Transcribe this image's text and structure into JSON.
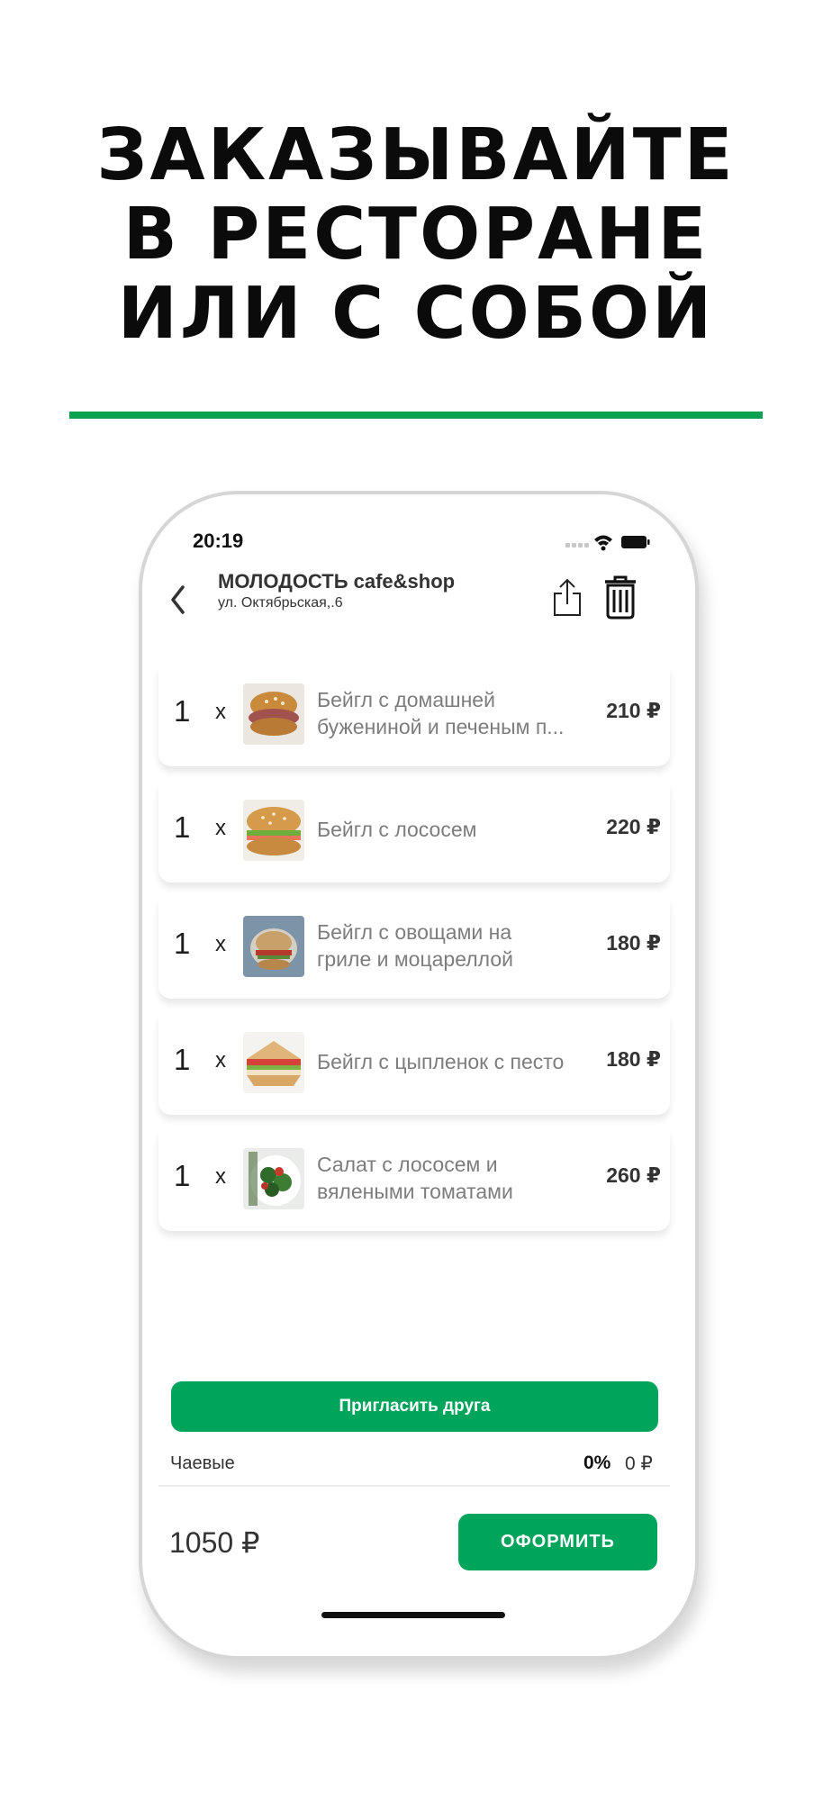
{
  "headline": {
    "line1": "ЗАКАЗЫВАЙТЕ",
    "line2": "В РЕСТОРАНЕ",
    "line3": "ИЛИ С СОБОЙ"
  },
  "status_bar": {
    "time": "20:19",
    "icons": [
      "signal-icon",
      "wifi-icon",
      "battery-icon"
    ]
  },
  "header": {
    "shop_name": "МОЛОДОСТЬ cafe&shop",
    "address": "ул. Октябрьская,.6",
    "icons": [
      "back-chevron-icon",
      "share-icon",
      "trash-icon"
    ]
  },
  "cart": {
    "items": [
      {
        "qty": "1",
        "times": "х",
        "name_line1": "Бейгл с домашней",
        "name_line2": "бужениной и печеным п...",
        "price": "210 ₽",
        "image": "bagel-pork-icon"
      },
      {
        "qty": "1",
        "times": "х",
        "name_line1": "Бейгл с лососем",
        "name_line2": "",
        "price": "220 ₽",
        "image": "bagel-salmon-icon"
      },
      {
        "qty": "1",
        "times": "х",
        "name_line1": "Бейгл с овощами на",
        "name_line2": "гриле и моцареллой",
        "price": "180 ₽",
        "image": "bagel-vegetables-icon"
      },
      {
        "qty": "1",
        "times": "х",
        "name_line1": "Бейгл с цыпленок с песто",
        "name_line2": "",
        "price": "180 ₽",
        "image": "bagel-chicken-icon"
      },
      {
        "qty": "1",
        "times": "х",
        "name_line1": "Салат с лососем и",
        "name_line2": "вялеными томатами",
        "price": "260 ₽",
        "image": "salad-salmon-icon"
      }
    ]
  },
  "invite_button": {
    "label": "Пригласить друга"
  },
  "tips": {
    "label": "Чаевые",
    "percent": "0%",
    "amount": "0 ₽"
  },
  "footer": {
    "total": "1050 ₽",
    "checkout_label": "ОФОРМИТЬ"
  },
  "colors": {
    "accent": "#00a45a",
    "divider": "#0aa150",
    "text": "#333333",
    "muted": "#7d7d7d"
  }
}
